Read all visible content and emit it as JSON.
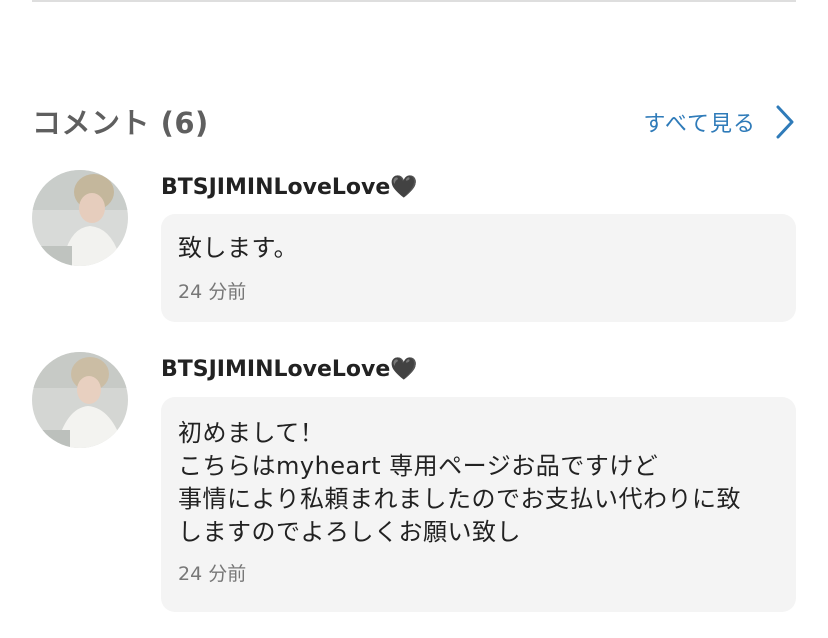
{
  "comments_section": {
    "title": "コメント (6)",
    "see_all_label": "すべて見る",
    "comments": [
      {
        "username": "BTSJIMINLoveLove🖤",
        "text": "致します。",
        "time": "24 分前"
      },
      {
        "username": "BTSJIMINLoveLove🖤",
        "text": "初めまして！\nこちらはmyheart 専用ページお品ですけど\n事情により私頼まれましたのでお支払い代わりに致\nしますのでよろしくお願い致し",
        "time": "24 分前"
      }
    ]
  },
  "colors": {
    "link": "#2f7bb9",
    "bubble_bg": "#f4f4f4",
    "title": "#5f5f5f"
  }
}
